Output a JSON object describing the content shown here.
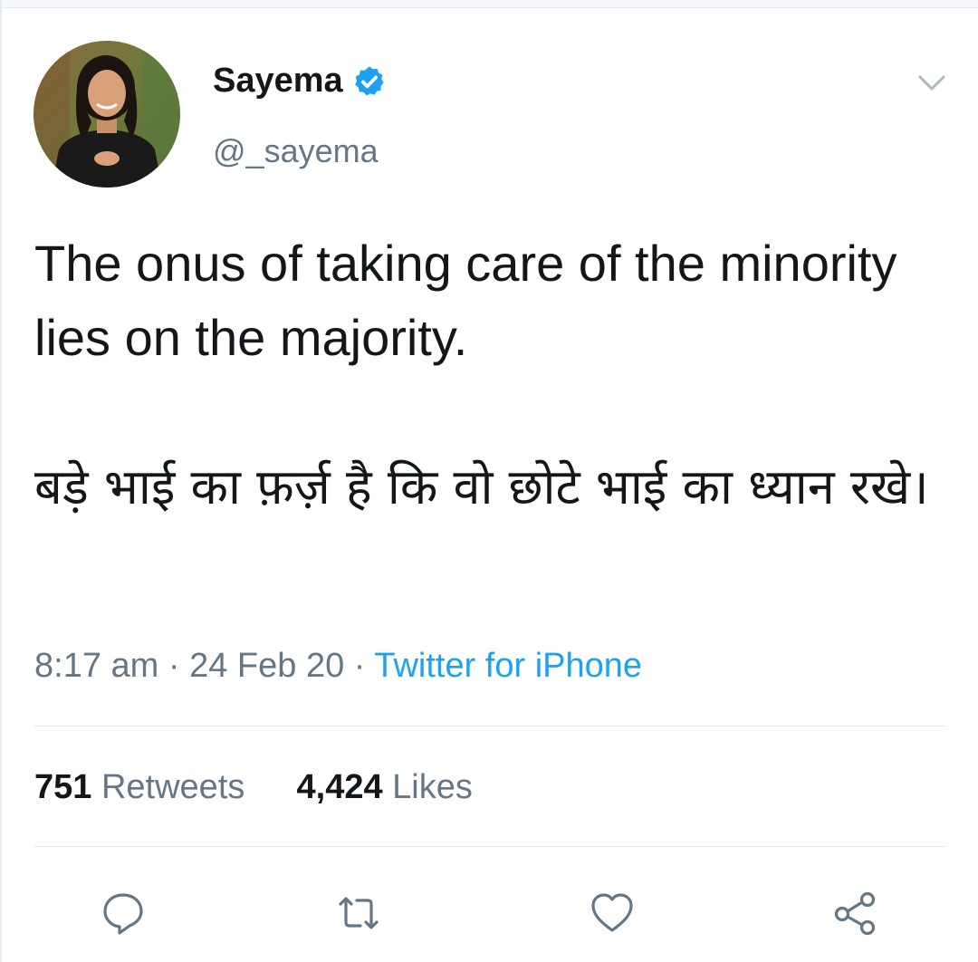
{
  "tweet": {
    "author": {
      "name": "Sayema",
      "handle": "@_sayema",
      "verified": true,
      "avatar": "profile-photo"
    },
    "text": {
      "english": "The onus of taking care of the minority lies on the majority.",
      "hindi": "बड़े भाई का फ़र्ज़ है कि वो छोटे भाई का ध्यान रखे।"
    },
    "meta": {
      "time": "8:17 am",
      "separator": "·",
      "date": "24 Feb 20",
      "source": "Twitter for iPhone"
    },
    "stats": {
      "retweets_count": "751",
      "retweets_label": "Retweets",
      "likes_count": "4,424",
      "likes_label": "Likes"
    },
    "actions": [
      "reply-icon",
      "retweet-icon",
      "like-icon",
      "share-icon"
    ]
  },
  "colors": {
    "text": "#14171a",
    "secondary": "#657786",
    "accent": "#1da1f2",
    "divider": "#e1e8ed"
  }
}
